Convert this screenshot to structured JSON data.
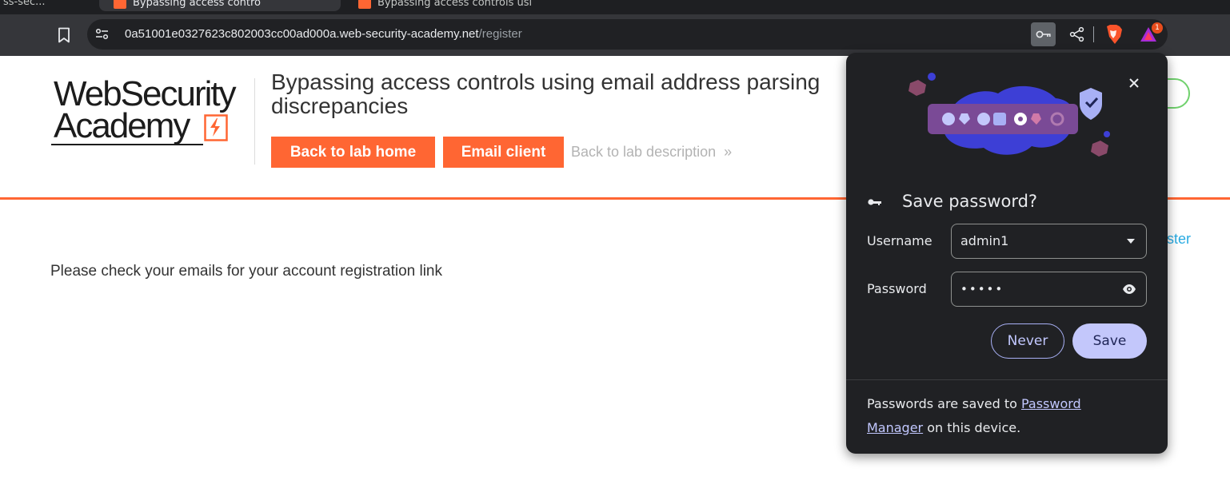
{
  "tabs": {
    "left_text": "ss-sec...",
    "active_title": "Bypassing access contro",
    "inactive_title": "Bypassing access controls usi",
    "brand_color": "#ff6633"
  },
  "toolbar": {
    "bookmark_icon": "bookmark-icon",
    "url_host": "0a51001e0327623c802003cc00ad000a.web-security-academy.net",
    "url_path": "/register",
    "rewards_badge": "1"
  },
  "page": {
    "logo_line1": "WebSecurity",
    "logo_line2": "Academy",
    "lab_title": "Bypassing access controls using email address parsing discrepancies",
    "back_to_lab_home": "Back to lab home",
    "email_client": "Email client",
    "back_to_lab_description": "Back to lab description",
    "chevron": "»",
    "register_link": "ster",
    "message": "Please check your emails for your account registration link",
    "accent_color": "#ff6633"
  },
  "password_bubble": {
    "title": "Save password?",
    "close": "✕",
    "username_label": "Username",
    "username_value": "admin1",
    "password_label": "Password",
    "password_value": "•••••",
    "never_button": "Never",
    "save_button": "Save",
    "footer_prefix": "Passwords are saved to ",
    "footer_link": "Password Manager",
    "footer_suffix": " on this device."
  }
}
